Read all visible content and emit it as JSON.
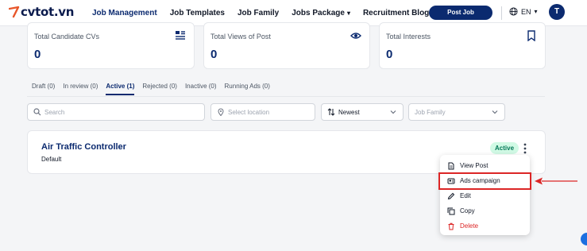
{
  "brand": {
    "name": "cvtot.vn"
  },
  "nav": {
    "items": [
      {
        "label": "Job Management",
        "active": true
      },
      {
        "label": "Job Templates",
        "active": false
      },
      {
        "label": "Job Family",
        "active": false
      },
      {
        "label": "Jobs Package",
        "active": false
      },
      {
        "label": "Recruitment Blog",
        "active": false
      }
    ],
    "post_job_label": "Post Job",
    "language": "EN",
    "avatar_initial": "T"
  },
  "stats": [
    {
      "label": "Total Candidate CVs",
      "value": "0",
      "icon": "list-card-icon"
    },
    {
      "label": "Total Views of Post",
      "value": "0",
      "icon": "eye-icon"
    },
    {
      "label": "Total Interests",
      "value": "0",
      "icon": "bookmark-icon"
    }
  ],
  "tabs": [
    {
      "label": "Draft (0)",
      "active": false
    },
    {
      "label": "In review (0)",
      "active": false
    },
    {
      "label": "Active (1)",
      "active": true
    },
    {
      "label": "Rejected (0)",
      "active": false
    },
    {
      "label": "Inactive (0)",
      "active": false
    },
    {
      "label": "Running Ads (0)",
      "active": false
    }
  ],
  "filters": {
    "search_placeholder": "Search",
    "location_placeholder": "Select location",
    "sort_value": "Newest",
    "job_family_placeholder": "Job Family"
  },
  "job": {
    "title": "Air Traffic Controller",
    "subtitle": "Default",
    "status": "Active"
  },
  "menu": {
    "items": [
      {
        "label": "View Post",
        "icon": "document-icon"
      },
      {
        "label": "Ads campaign",
        "icon": "ads-icon",
        "highlighted": true
      },
      {
        "label": "Edit",
        "icon": "pencil-icon"
      },
      {
        "label": "Copy",
        "icon": "copy-icon"
      },
      {
        "label": "Delete",
        "icon": "trash-icon"
      }
    ]
  },
  "colors": {
    "brand_navy": "#0b2a6f",
    "status_active_bg": "#d1fae5",
    "status_active_text": "#047857",
    "danger": "#dc2626",
    "annotation": "#dc2626"
  }
}
